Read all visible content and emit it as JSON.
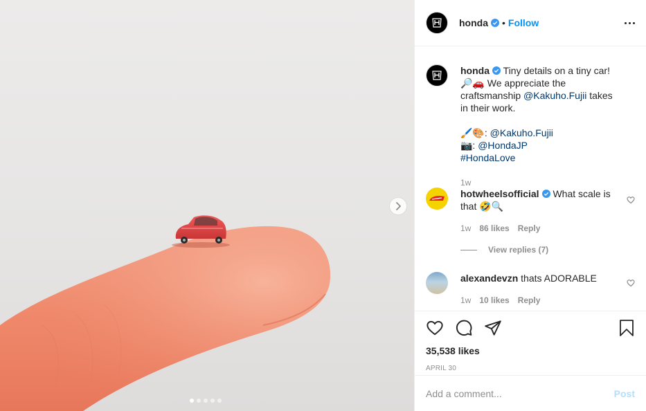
{
  "header": {
    "username": "honda",
    "separator": "•",
    "follow_label": "Follow"
  },
  "caption": {
    "username": "honda",
    "text_1": "Tiny details on a tiny car! 🔎🚗 We appreciate the craftsmanship",
    "mention_1": "@Kakuho.Fujii",
    "text_2": "takes in their work.",
    "line2_prefix": "🖌️🎨:",
    "line2_mention": "@Kakuho.Fujii",
    "line3_prefix": "📷:",
    "line3_mention": "@HondaJP",
    "hashtag": "#HondaLove",
    "time": "1w"
  },
  "comments": [
    {
      "username": "hotwheelsofficial",
      "text": "What scale is that 🤣🔍",
      "time": "1w",
      "likes": "86 likes",
      "reply": "Reply",
      "view_replies": "View replies (7)"
    },
    {
      "username": "alexandevzn",
      "text": "thats ADORABLE",
      "time": "1w",
      "likes": "10 likes",
      "reply": "Reply"
    }
  ],
  "likes": "35,538 likes",
  "date": "APRIL 30",
  "comment_box": {
    "placeholder": "Add a comment...",
    "post_label": "Post"
  },
  "carousel": {
    "count": 5,
    "active_index": 0
  },
  "colors": {
    "link": "#00376b",
    "follow": "#0095f6",
    "verified": "#3897f0",
    "muted": "#8e8e8e",
    "post_disabled": "#b2dffc"
  },
  "icons": [
    "honda-logo-icon",
    "verified-icon",
    "more-icon",
    "chevron-right-icon",
    "heart-icon",
    "comment-icon",
    "share-icon",
    "bookmark-icon"
  ]
}
